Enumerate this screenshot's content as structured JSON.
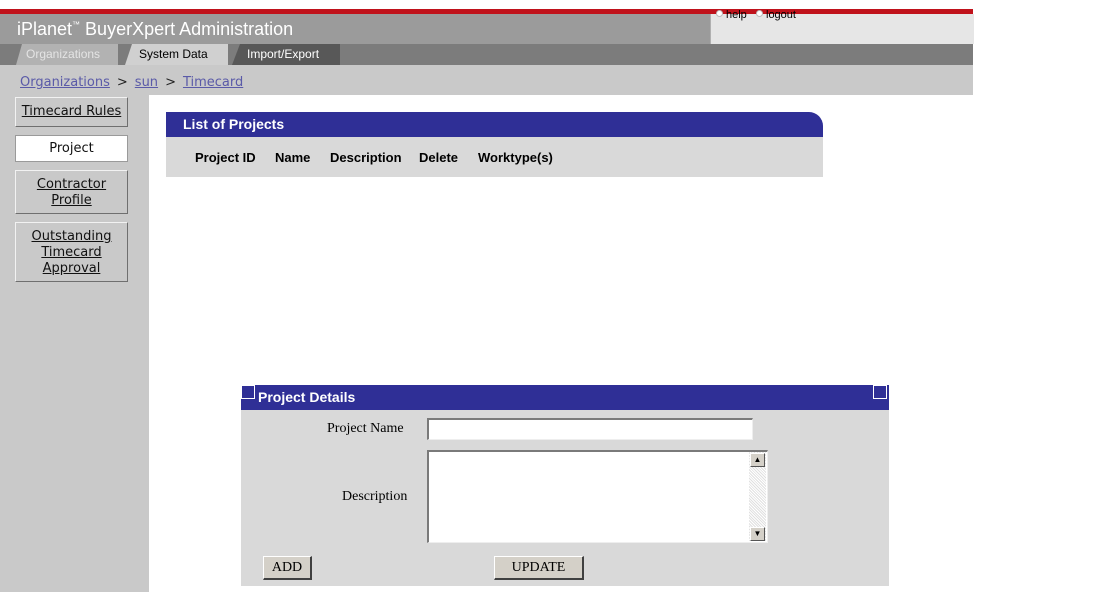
{
  "app": {
    "title": "iPlanet",
    "title_tm": "™",
    "title_rest": " BuyerXpert Administration"
  },
  "util": {
    "help": "help",
    "logout": "logout"
  },
  "tabs": [
    {
      "label": "Organizations",
      "active": true
    },
    {
      "label": "System Data"
    },
    {
      "label": "Import/Export"
    }
  ],
  "breadcrumb": {
    "items": [
      "Organizations",
      "sun",
      "Timecard"
    ],
    "separator": ">"
  },
  "sidebar": {
    "items": [
      {
        "label": "Timecard Rules"
      },
      {
        "label": "Project",
        "active": true
      },
      {
        "label_lines": [
          "Contractor",
          "Profile"
        ]
      },
      {
        "label_lines": [
          "Outstanding",
          "Timecard",
          "Approval"
        ]
      }
    ]
  },
  "projects_list": {
    "title": "List of Projects",
    "columns": [
      "Project ID",
      "Name",
      "Description",
      "Delete",
      "Worktype(s)"
    ],
    "rows": []
  },
  "project_details": {
    "title": "Project Details",
    "name_label": "Project Name",
    "name_value": "",
    "description_label": "Description",
    "description_value": "",
    "add_label": "ADD",
    "update_label": "UPDATE"
  },
  "colors": {
    "accent_red": "#c0121b",
    "panel_blue": "#2f2f96",
    "link": "#5a5aa8"
  }
}
